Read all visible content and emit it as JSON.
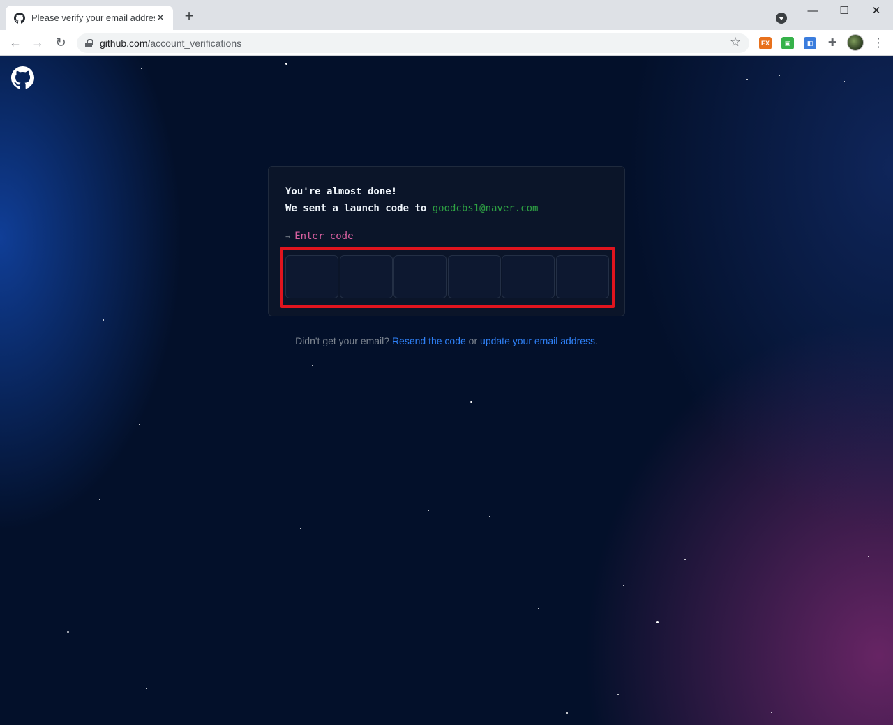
{
  "browser": {
    "tab_title": "Please verify your email address",
    "tab_close": "✕",
    "new_tab": "+",
    "url_host": "github.com",
    "url_path": "/account_verifications",
    "window_minimize": "—",
    "window_maximize": "☐",
    "window_close": "✕",
    "extensions": [
      {
        "name": "extension-orange-icon",
        "color": "#e8711c"
      },
      {
        "name": "extension-green-icon",
        "color": "#36b24a"
      },
      {
        "name": "extension-blue-icon",
        "color": "#3b7ddd"
      }
    ]
  },
  "verification": {
    "heading": "You're almost done!",
    "sent_prefix": "We sent a launch code to ",
    "email": "goodcbs1@naver.com",
    "prompt_arrow": "→",
    "prompt_label": "Enter code",
    "code_values": [
      "",
      "",
      "",
      "",
      "",
      ""
    ]
  },
  "help": {
    "question": "Didn't get your email? ",
    "resend_link": "Resend the code",
    "or_text": " or ",
    "update_link": "update your email address",
    "period": "."
  },
  "colors": {
    "background": "#03102a",
    "highlight_frame": "#e0141e",
    "email": "#2ea043",
    "prompt": "#db61a2",
    "link": "#2f81f7"
  }
}
